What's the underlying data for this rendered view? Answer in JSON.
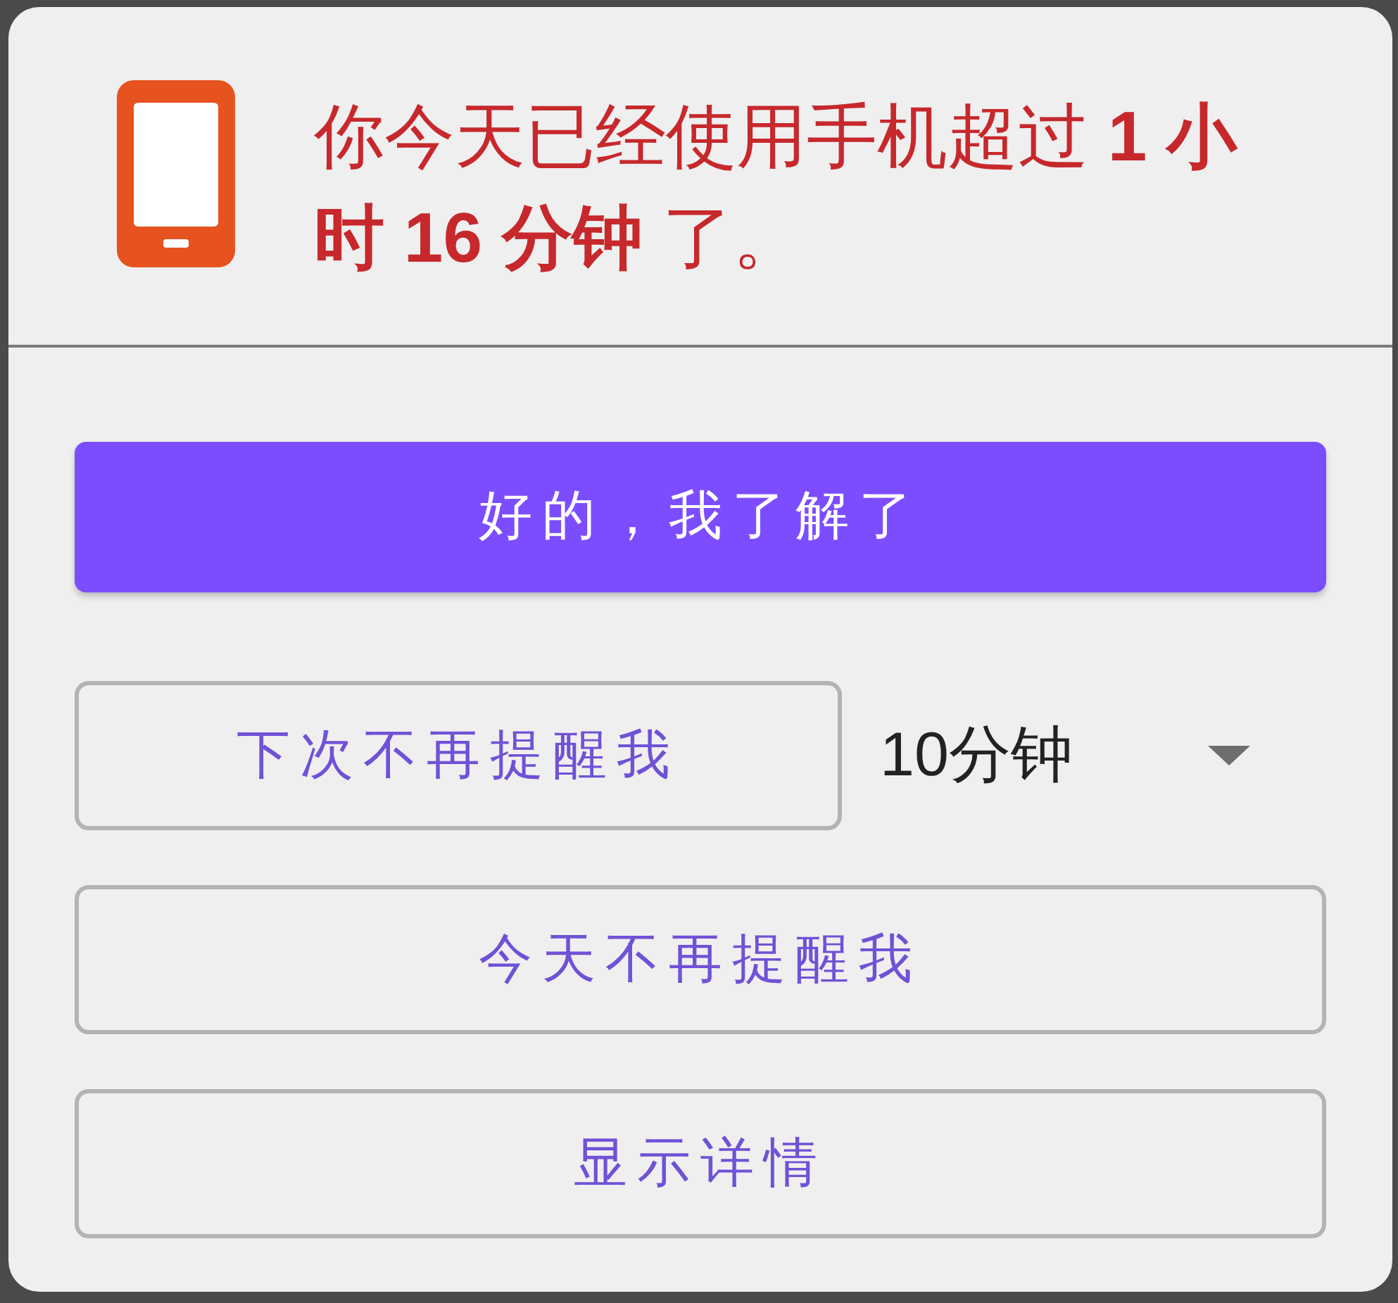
{
  "message": {
    "text": "你今天已经使用手机超过 **1 小时 16 分钟** 了。"
  },
  "primary_button": {
    "label": "好的，我了解了"
  },
  "snooze": {
    "button": {
      "label": "下次不再提醒我"
    },
    "interval_select": {
      "value": "10分钟"
    }
  },
  "buttons": [
    {
      "label": "今天不再提醒我"
    },
    {
      "label": "显示详情"
    }
  ]
}
